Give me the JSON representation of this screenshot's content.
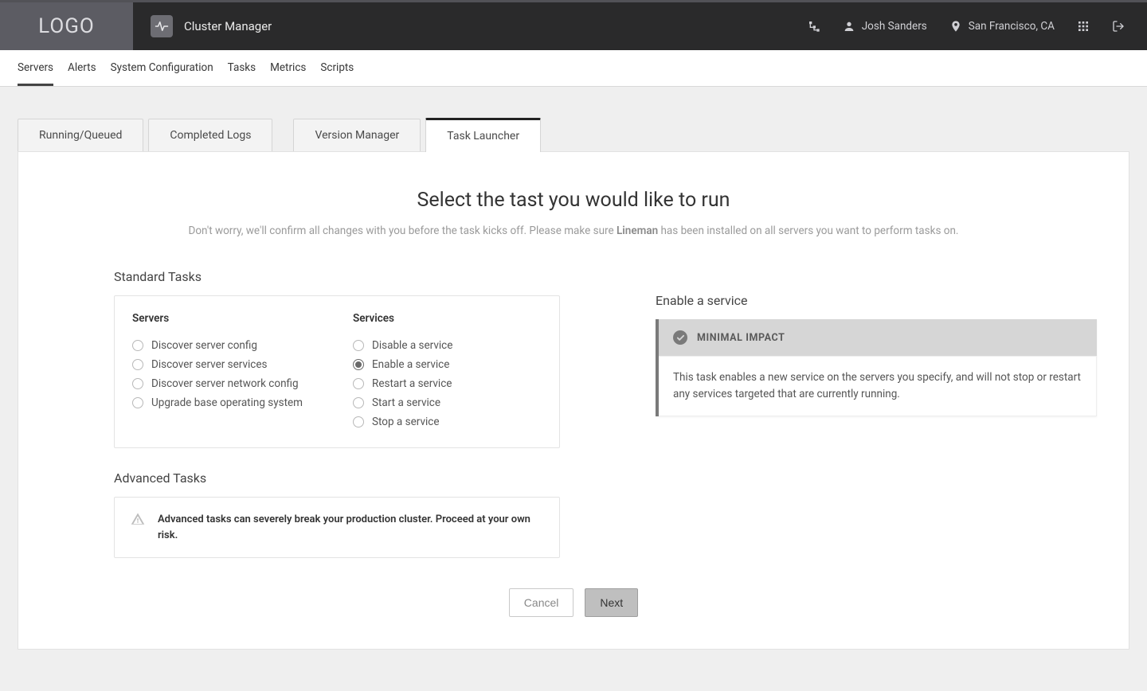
{
  "logo_text": "LOGO",
  "app_title": "Cluster Manager",
  "topbar": {
    "user_name": "Josh Sanders",
    "location": "San Francisco, CA"
  },
  "nav": {
    "items": [
      "Servers",
      "Alerts",
      "System Configuration",
      "Tasks",
      "Metrics",
      "Scripts"
    ],
    "active_index": 0
  },
  "tabs": {
    "items": [
      "Running/Queued",
      "Completed Logs",
      "Version Manager",
      "Task Launcher"
    ],
    "active_index": 3
  },
  "heading": "Select the tast you would like to run",
  "subheading_pre": "Don't worry, we'll confirm all changes with you before the task kicks off. Please make sure ",
  "subheading_bold": "Lineman",
  "subheading_post": " has been installed on all servers you want to perform tasks on.",
  "standard_label": "Standard Tasks",
  "task_groups": [
    {
      "title": "Servers",
      "options": [
        "Discover server config",
        "Discover server services",
        "Discover server network config",
        "Upgrade base operating system"
      ]
    },
    {
      "title": "Services",
      "options": [
        "Disable a service",
        "Enable a service",
        "Restart a service",
        "Start a service",
        "Stop a service"
      ]
    }
  ],
  "selected_task": "Enable a service",
  "advanced_label": "Advanced Tasks",
  "advanced_warning": "Advanced tasks can severely break your production cluster. Proceed at your own risk.",
  "detail": {
    "title": "Enable a service",
    "badge": "MINIMAL IMPACT",
    "body": "This task enables a new service on the servers you specify, and will not stop or restart any services targeted that are currently running."
  },
  "buttons": {
    "cancel": "Cancel",
    "next": "Next"
  }
}
